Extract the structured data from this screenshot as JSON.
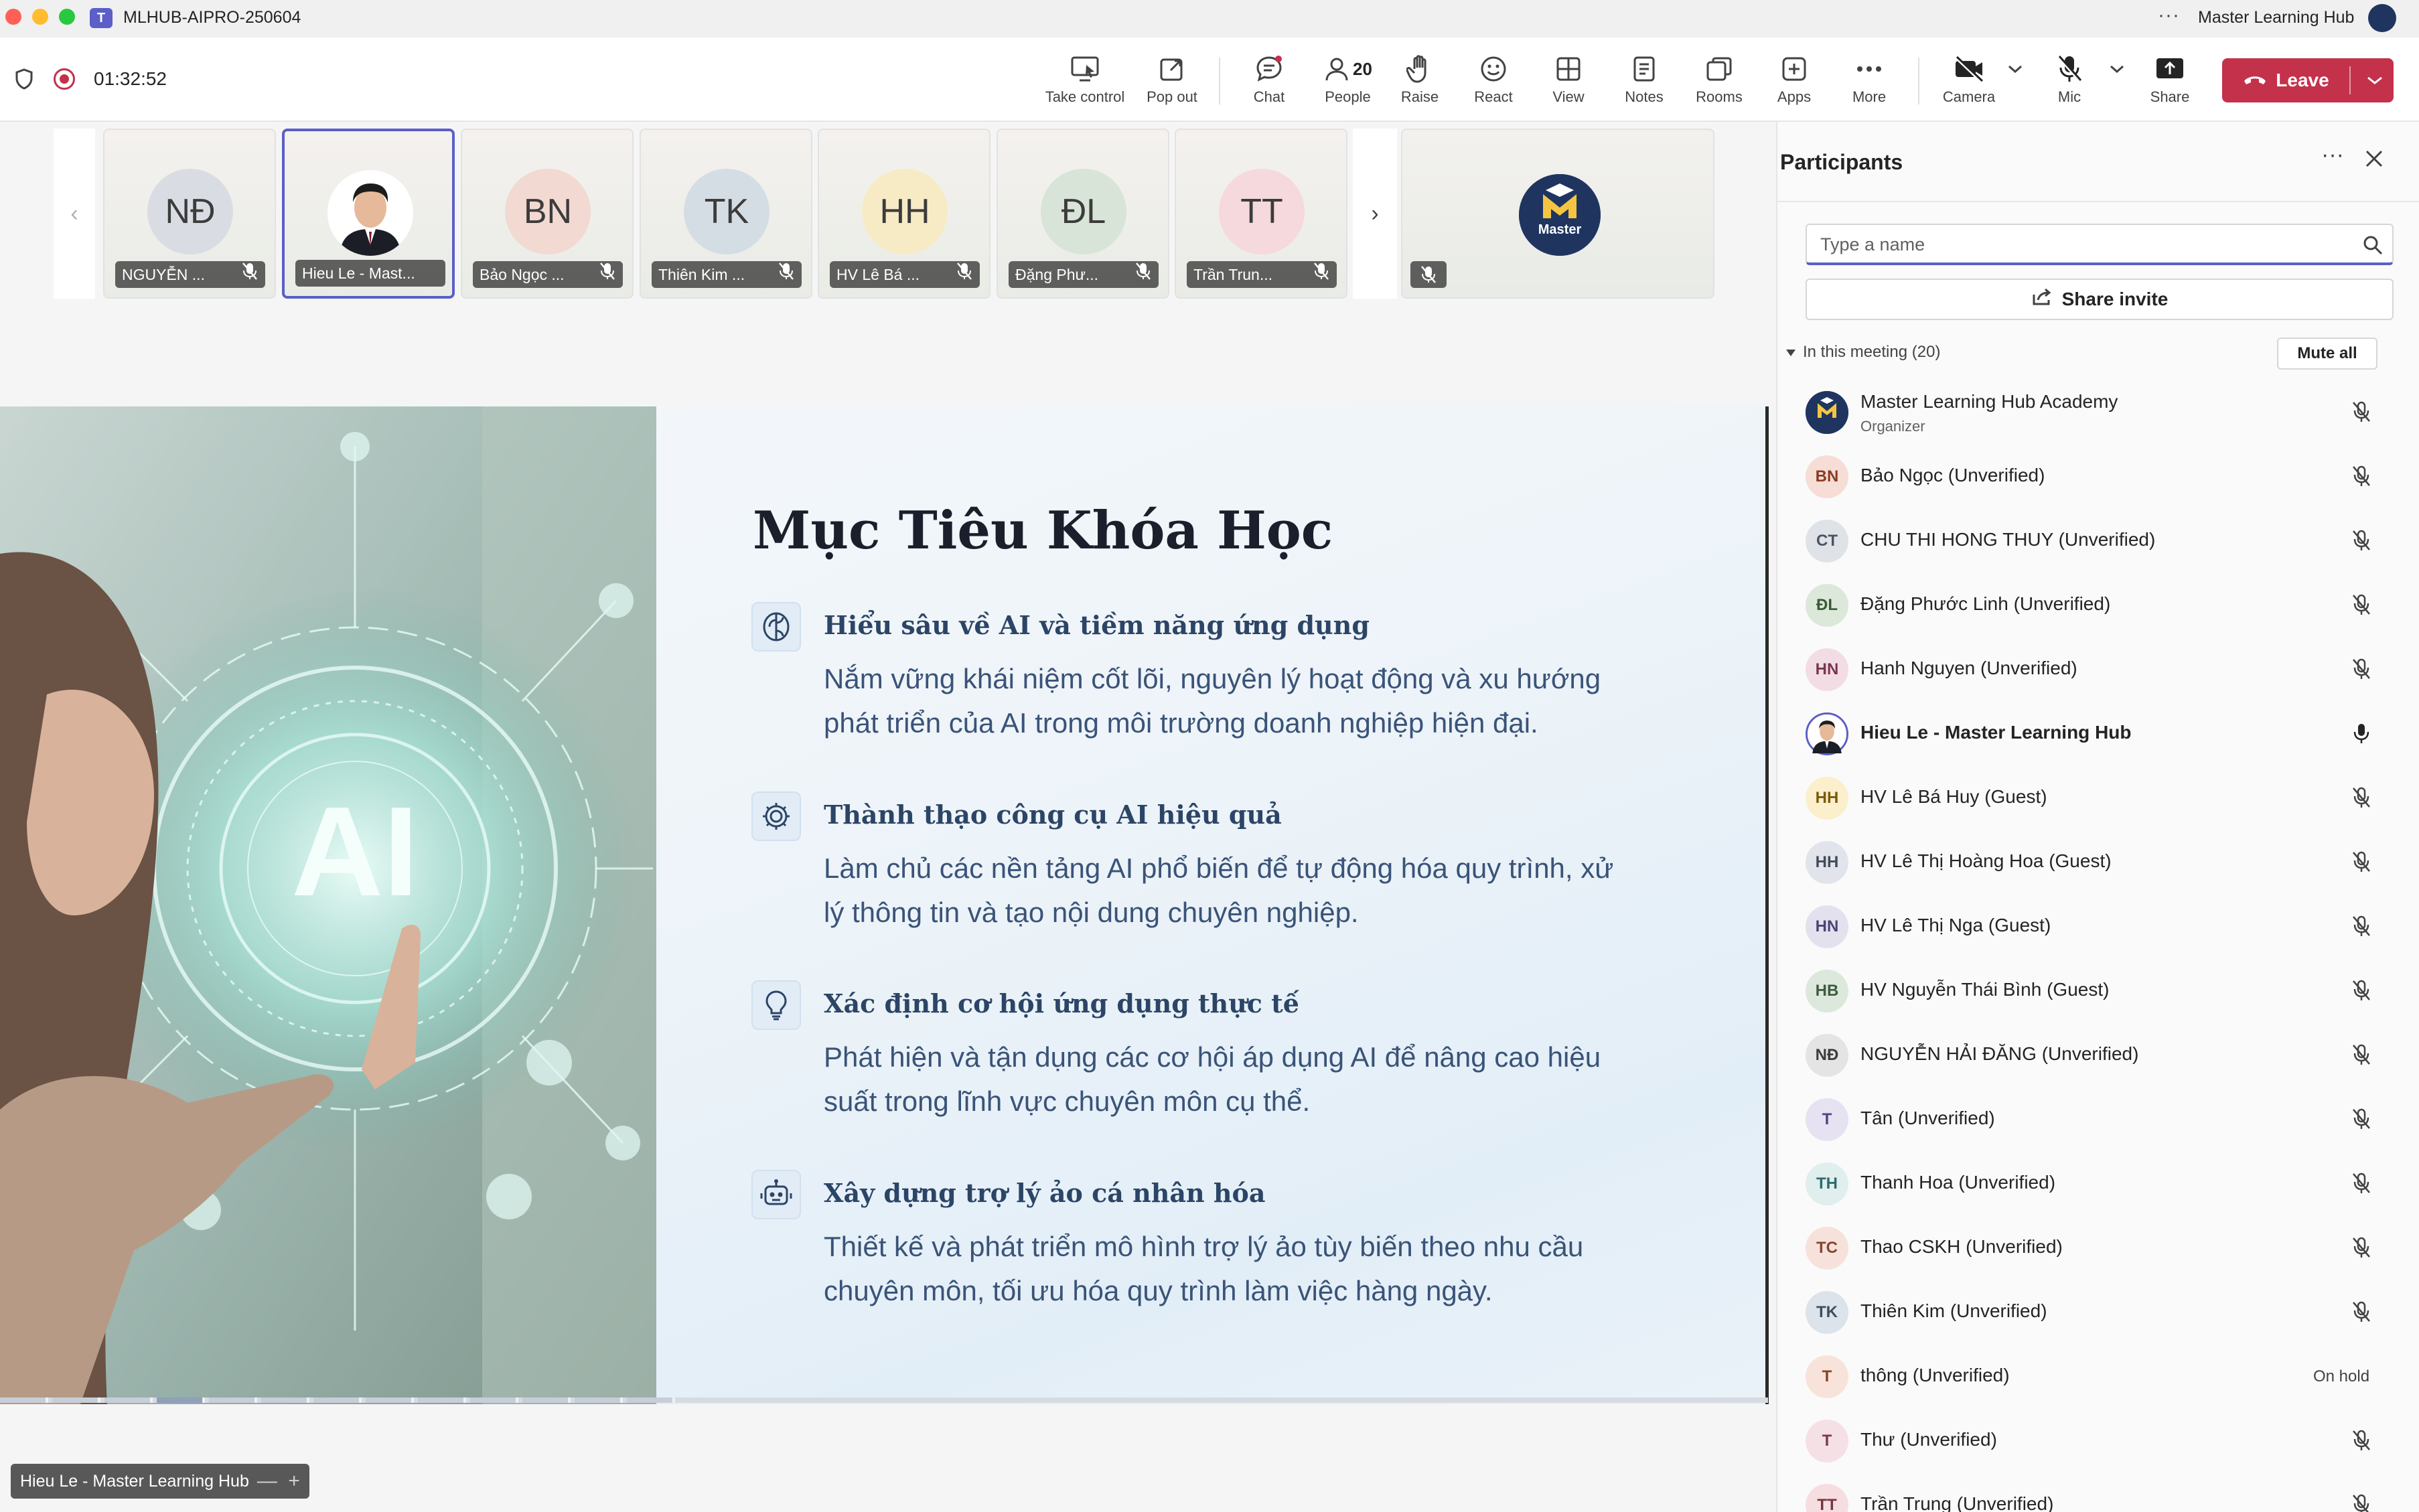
{
  "window": {
    "title": "MLHUB-AIPRO-250604",
    "account_name": "Master Learning Hub",
    "more_icon": "more-horizontal-icon"
  },
  "header": {
    "timer": "01:32:52",
    "people_count": "20",
    "toolbar": {
      "take_control": "Take control",
      "pop_out": "Pop out",
      "chat": "Chat",
      "people": "People",
      "raise": "Raise",
      "react": "React",
      "view": "View",
      "notes": "Notes",
      "rooms": "Rooms",
      "apps": "Apps",
      "more": "More",
      "camera": "Camera",
      "mic": "Mic",
      "share": "Share",
      "leave": "Leave"
    },
    "colors": {
      "accent": "#5b5fc7",
      "leave": "#c4314b",
      "notification_dot": "#c4314b"
    }
  },
  "gallery": {
    "tiles": [
      {
        "initials": "NĐ",
        "name": "NGUYỄN ...",
        "avatar_color": "#d9dde3"
      },
      {
        "initials": "",
        "name": "Hieu Le - Mast...",
        "avatar_color": "#ffffff"
      },
      {
        "initials": "BN",
        "name": "Bảo Ngọc ...",
        "avatar_color": "#f2d9d2"
      },
      {
        "initials": "TK",
        "name": "Thiên Kim ...",
        "avatar_color": "#d5dde4"
      },
      {
        "initials": "HH",
        "name": "HV Lê Bá ...",
        "avatar_color": "#f7ebc6"
      },
      {
        "initials": "ĐL",
        "name": "Đặng Phư...",
        "avatar_color": "#d8e4d8"
      },
      {
        "initials": "TT",
        "name": "Trần Trun...",
        "avatar_color": "#f6d9dc"
      }
    ],
    "organizer_logo_text": "Master"
  },
  "slide": {
    "title": "Mục Tiêu Khóa Học",
    "photo_label": "AI",
    "goals": [
      {
        "icon": "brain-icon",
        "heading": "Hiểu sâu về AI và tiềm năng ứng dụng",
        "desc_line1": "Nắm vững khái niệm cốt lõi, nguyên lý hoạt động và xu hướng",
        "desc_line2": "phát triển của AI trong môi trường doanh nghiệp hiện đại."
      },
      {
        "icon": "gear-icon",
        "heading": "Thành thạo công cụ AI hiệu quả",
        "desc_line1": "Làm chủ các nền tảng AI phổ biến để tự động hóa quy trình, xử",
        "desc_line2": "lý thông tin và tạo nội dung chuyên nghiệp."
      },
      {
        "icon": "lightbulb-icon",
        "heading": "Xác định cơ hội ứng dụng thực tế",
        "desc_line1": "Phát hiện và tận dụng các cơ hội áp dụng AI để nâng cao hiệu",
        "desc_line2": "suất trong lĩnh vực chuyên môn cụ thể."
      },
      {
        "icon": "robot-icon",
        "heading": "Xây dựng trợ lý ảo cá nhân hóa",
        "desc_line1": "Thiết kế và phát triển mô hình trợ lý ảo tùy biến theo nhu cầu",
        "desc_line2": "chuyên môn, tối ưu hóa quy trình làm việc hàng ngày."
      }
    ]
  },
  "presenter_label": "Hieu Le - Master Learning Hub",
  "presenter_controls": {
    "minus": "—",
    "plus": "+"
  },
  "participants_panel": {
    "title": "Participants",
    "search_placeholder": "Type a name",
    "share_invite": "Share invite",
    "section_label": "In this meeting (20)",
    "mute_all": "Mute all",
    "people": [
      {
        "initials": "",
        "name": "Master Learning Hub Academy",
        "role": "Organizer",
        "status": "mic-off",
        "avatar_bg": "#1f3560",
        "avatar_fg": "#f5c542"
      },
      {
        "initials": "BN",
        "name": "Bảo Ngọc (Unverified)",
        "role": "",
        "status": "mic-off",
        "avatar_bg": "#f6ddd5",
        "avatar_fg": "#8a3b22"
      },
      {
        "initials": "CT",
        "name": "CHU THI HONG THUY (Unverified)",
        "role": "",
        "status": "mic-off",
        "avatar_bg": "#dfe3e8",
        "avatar_fg": "#4a5563"
      },
      {
        "initials": "ĐL",
        "name": "Đặng Phước Linh (Unverified)",
        "role": "",
        "status": "mic-off",
        "avatar_bg": "#dbe8da",
        "avatar_fg": "#3b5b36"
      },
      {
        "initials": "HN",
        "name": "Hanh Nguyen (Unverified)",
        "role": "",
        "status": "mic-off",
        "avatar_bg": "#f3dde4",
        "avatar_fg": "#7a3550"
      },
      {
        "initials": "",
        "name": "Hieu Le - Master Learning Hub",
        "role": "",
        "status": "mic-on",
        "avatar_bg": "#ffffff",
        "avatar_fg": "#242424"
      },
      {
        "initials": "HH",
        "name": "HV Lê Bá Huy (Guest)",
        "role": "",
        "status": "mic-off",
        "avatar_bg": "#fbefcc",
        "avatar_fg": "#7a5a0b"
      },
      {
        "initials": "HH",
        "name": "HV Lê Thị Hoàng Hoa (Guest)",
        "role": "",
        "status": "mic-off",
        "avatar_bg": "#e1e4ea",
        "avatar_fg": "#414b5c"
      },
      {
        "initials": "HN",
        "name": "HV Lê Thị Nga (Guest)",
        "role": "",
        "status": "mic-off",
        "avatar_bg": "#e4e1ef",
        "avatar_fg": "#4b4478"
      },
      {
        "initials": "HB",
        "name": "HV Nguyễn Thái Bình (Guest)",
        "role": "",
        "status": "mic-off",
        "avatar_bg": "#dde8dd",
        "avatar_fg": "#3d5b3d"
      },
      {
        "initials": "NĐ",
        "name": "NGUYỄN HẢI ĐĂNG (Unverified)",
        "role": "",
        "status": "mic-off",
        "avatar_bg": "#e4e4e4",
        "avatar_fg": "#3d3d3d"
      },
      {
        "initials": "T",
        "name": "Tân (Unverified)",
        "role": "",
        "status": "mic-off",
        "avatar_bg": "#e6e2f2",
        "avatar_fg": "#4d4680"
      },
      {
        "initials": "TH",
        "name": "Thanh Hoa (Unverified)",
        "role": "",
        "status": "mic-off",
        "avatar_bg": "#e0eeee",
        "avatar_fg": "#2f6b6b"
      },
      {
        "initials": "TC",
        "name": "Thao CSKH (Unverified)",
        "role": "",
        "status": "mic-off",
        "avatar_bg": "#f6e2db",
        "avatar_fg": "#874631"
      },
      {
        "initials": "TK",
        "name": "Thiên Kim (Unverified)",
        "role": "",
        "status": "mic-off",
        "avatar_bg": "#dce3ea",
        "avatar_fg": "#3e4e5e"
      },
      {
        "initials": "T",
        "name": "thông (Unverified)",
        "role": "",
        "status": "On hold",
        "avatar_bg": "#f8e3da",
        "avatar_fg": "#8a4327"
      },
      {
        "initials": "T",
        "name": "Thư (Unverified)",
        "role": "",
        "status": "mic-off",
        "avatar_bg": "#f5e0e6",
        "avatar_fg": "#7b3a4d"
      },
      {
        "initials": "TT",
        "name": "Trần Trung (Unverified)",
        "role": "",
        "status": "mic-off",
        "avatar_bg": "#f6dde0",
        "avatar_fg": "#7b3540"
      }
    ]
  }
}
